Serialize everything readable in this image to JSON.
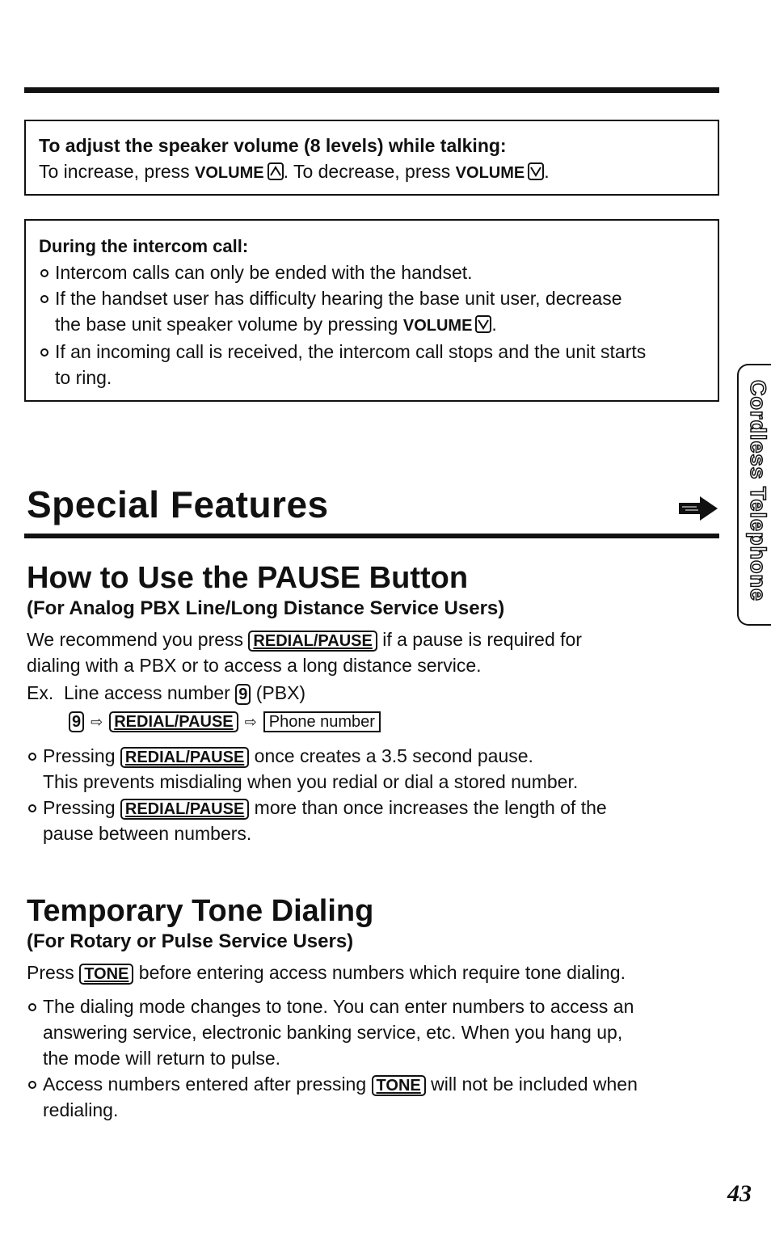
{
  "box_speaker": {
    "title": "To adjust the speaker volume (8 levels) while talking:",
    "line_prefix": "To increase, press ",
    "volume_label": "VOLUME",
    "line_mid": ". To decrease, press ",
    "line_end": "."
  },
  "box_intercom": {
    "title": "During the intercom call:",
    "bullet1": "Intercom calls can only be ended with the handset.",
    "bullet2_a": "If the handset user has difficulty hearing the base unit user, decrease",
    "bullet2_b": "the base unit speaker volume by pressing ",
    "volume_label": "VOLUME",
    "bullet2_end": ".",
    "bullet3_a": "If an incoming call is received, the intercom call stops and the unit starts",
    "bullet3_b": "to ring."
  },
  "section_title": "Special Features",
  "side_tab": "Cordless Telephone",
  "pause": {
    "heading": "How to Use the PAUSE Button",
    "subheading": "(For Analog PBX Line/Long Distance Service Users)",
    "intro_a": "We recommend you press ",
    "key": "REDIAL/PAUSE",
    "intro_b": " if a pause is required for",
    "intro_c": "dialing with a PBX or to access a long distance service.",
    "example_a": "Ex.  Line access number ",
    "digit": "9",
    "example_b": " (PBX)",
    "phone_number": "Phone number",
    "b1_a": "Pressing ",
    "b1_b": " once creates a 3.5 second pause.",
    "b1_c": "This prevents misdialing when you redial or dial a stored number.",
    "b2_a": "Pressing ",
    "b2_b": " more than once increases the length of the",
    "b2_c": "pause between numbers."
  },
  "tone": {
    "heading": "Temporary Tone Dialing",
    "subheading": "(For Rotary or Pulse Service Users)",
    "intro_a": "Press ",
    "key": "TONE",
    "intro_b": " before entering access numbers which require tone dialing.",
    "b1_a": "The dialing mode changes to tone. You can enter numbers to access an",
    "b1_b": "answering service, electronic banking service, etc. When you hang up,",
    "b1_c": "the mode will return to pulse.",
    "b2_a": "Access numbers entered after pressing ",
    "b2_b": " will not be included when",
    "b2_c": "redialing."
  },
  "page_number": "43"
}
